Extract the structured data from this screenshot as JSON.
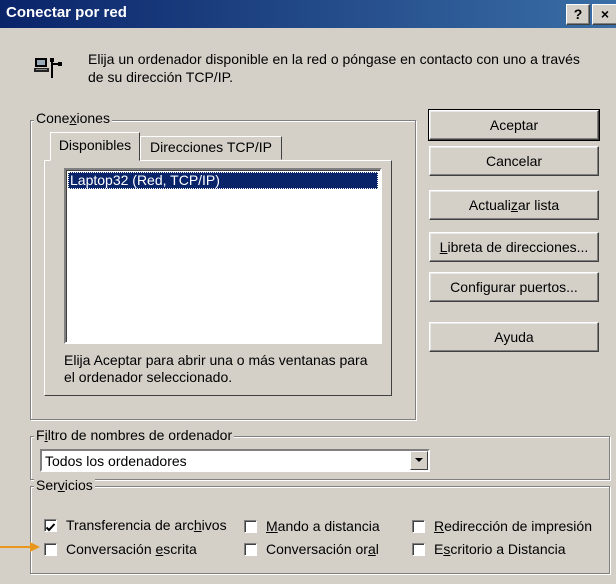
{
  "window": {
    "title": "Conectar por red",
    "help_button": "?",
    "close_button": "×"
  },
  "intro": {
    "icon": "network-computer-icon",
    "text": "Elija un ordenador disponible en la red o póngase en contacto con uno a través de su dirección TCP/IP."
  },
  "connections": {
    "group_label_pre": "Cone",
    "group_label_u": "x",
    "group_label_post": "iones",
    "tabs": [
      {
        "label": "Disponibles",
        "selected": true
      },
      {
        "label": "Direcciones TCP/IP",
        "selected": false
      }
    ],
    "list_items": [
      "Laptop32 (Red, TCP/IP)"
    ],
    "selected_item": "Laptop32 (Red, TCP/IP)",
    "hint": "Elija Aceptar para abrir una o más ventanas para el ordenador seleccionado."
  },
  "buttons": {
    "accept": "Aceptar",
    "cancel": "Cancelar",
    "refresh_pre": "Actuali",
    "refresh_u": "z",
    "refresh_post": "ar lista",
    "address_book_pre": "",
    "address_book_u": "L",
    "address_book_post": "ibreta de direcciones...",
    "configure_pre": "Confi",
    "configure_u": "g",
    "configure_post": "urar puertos...",
    "help": "Ayuda"
  },
  "filter": {
    "label_pre": "F",
    "label_u": "i",
    "label_post": "ltro de nombres de ordenador",
    "value": "Todos los ordenadores"
  },
  "services": {
    "label_pre": "Ser",
    "label_u": "v",
    "label_post": "icios",
    "items": [
      {
        "pre": "Transferencia de arc",
        "u": "h",
        "post": "ivos",
        "checked": true
      },
      {
        "pre": "",
        "u": "M",
        "post": "ando a distancia",
        "checked": false
      },
      {
        "pre": "",
        "u": "R",
        "post": "edirección de impresión",
        "checked": false
      },
      {
        "pre": "Conversación ",
        "u": "e",
        "post": "scrita",
        "checked": false
      },
      {
        "pre": "Conversación or",
        "u": "a",
        "post": "l",
        "checked": false
      },
      {
        "pre": "E",
        "u": "s",
        "post": "critorio a Distancia",
        "checked": false
      }
    ]
  },
  "colors": {
    "face": "#d4d0c8",
    "title_start": "#0a246a",
    "title_end": "#3a6ea5",
    "selection": "#0a246a",
    "callout_arrow": "#e8961c"
  }
}
